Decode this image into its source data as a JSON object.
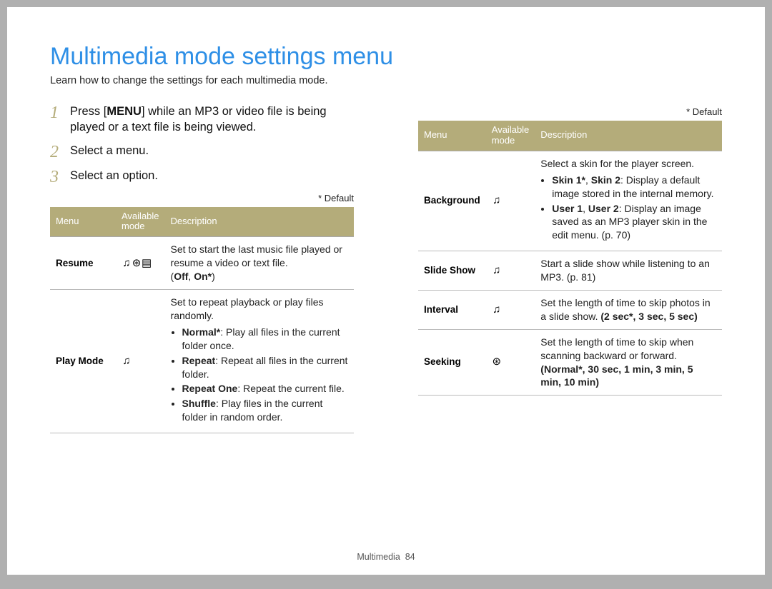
{
  "title": "Multimedia mode settings menu",
  "subtitle": "Learn how to change the settings for each multimedia mode.",
  "steps": [
    {
      "num": "1",
      "pre": "Press [",
      "key": "MENU",
      "post": "] while an MP3 or video file is being played or a text file is being viewed."
    },
    {
      "num": "2",
      "text": "Select a menu."
    },
    {
      "num": "3",
      "text": "Select an option."
    }
  ],
  "default_note": "* Default",
  "table_headers": {
    "c1": "Menu",
    "c2": "Available mode",
    "c3": "Description"
  },
  "icons": {
    "music": "♫",
    "video": "⊛",
    "text": "▤"
  },
  "left_rows": [
    {
      "menu": "Resume",
      "modes": [
        "music",
        "video",
        "text"
      ],
      "desc_plain": "Set to start the last music file played or resume a video or text file.",
      "options_inline": [
        "Off",
        "On*"
      ]
    },
    {
      "menu": "Play Mode",
      "modes": [
        "music"
      ],
      "desc_plain": "Set to repeat playback or play files randomly.",
      "bullets": [
        {
          "b": "Normal*",
          "t": ": Play all files in the current folder once."
        },
        {
          "b": "Repeat",
          "t": ": Repeat all files in the current folder."
        },
        {
          "b": "Repeat One",
          "t": ": Repeat the current file."
        },
        {
          "b": "Shuffle",
          "t": ": Play files in the current folder in random order."
        }
      ]
    }
  ],
  "right_rows": [
    {
      "menu": "Background",
      "modes": [
        "music"
      ],
      "desc_plain": "Select a skin for the player screen.",
      "bullets": [
        {
          "b": "Skin 1*",
          "b2": "Skin 2",
          "t": ": Display a default image stored in the internal memory."
        },
        {
          "b": "User 1",
          "b2": "User 2",
          "t": ": Display an image saved as an MP3 player skin in the edit menu. (p. 70)"
        }
      ]
    },
    {
      "menu": "Slide Show",
      "modes": [
        "music"
      ],
      "desc_plain": "Start a slide show while listening to an MP3. (p. 81)"
    },
    {
      "menu": "Interval",
      "modes": [
        "music"
      ],
      "desc_plain": "Set the length of time to skip photos in a slide show.",
      "options_trail": "(2 sec*, 3 sec, 5 sec)"
    },
    {
      "menu": "Seeking",
      "modes": [
        "video"
      ],
      "desc_plain": "Set the length of time to skip when scanning backward or forward.",
      "options_trail": "(Normal*, 30 sec, 1 min, 3 min, 5 min, 10 min)"
    }
  ],
  "footer": {
    "section": "Multimedia",
    "page": "84"
  }
}
